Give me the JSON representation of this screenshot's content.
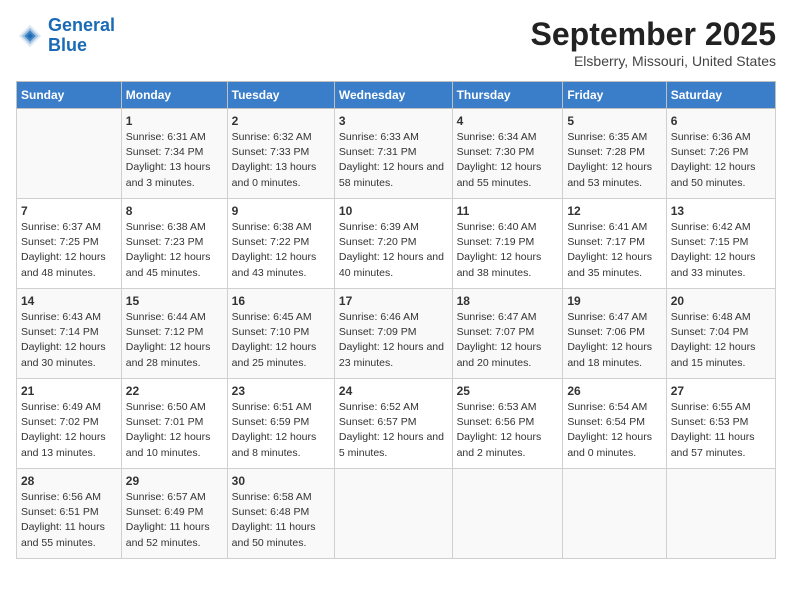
{
  "logo": {
    "line1": "General",
    "line2": "Blue"
  },
  "title": "September 2025",
  "subtitle": "Elsberry, Missouri, United States",
  "days_of_week": [
    "Sunday",
    "Monday",
    "Tuesday",
    "Wednesday",
    "Thursday",
    "Friday",
    "Saturday"
  ],
  "weeks": [
    [
      {
        "day": "",
        "sunrise": "",
        "sunset": "",
        "daylight": ""
      },
      {
        "day": "1",
        "sunrise": "Sunrise: 6:31 AM",
        "sunset": "Sunset: 7:34 PM",
        "daylight": "Daylight: 13 hours and 3 minutes."
      },
      {
        "day": "2",
        "sunrise": "Sunrise: 6:32 AM",
        "sunset": "Sunset: 7:33 PM",
        "daylight": "Daylight: 13 hours and 0 minutes."
      },
      {
        "day": "3",
        "sunrise": "Sunrise: 6:33 AM",
        "sunset": "Sunset: 7:31 PM",
        "daylight": "Daylight: 12 hours and 58 minutes."
      },
      {
        "day": "4",
        "sunrise": "Sunrise: 6:34 AM",
        "sunset": "Sunset: 7:30 PM",
        "daylight": "Daylight: 12 hours and 55 minutes."
      },
      {
        "day": "5",
        "sunrise": "Sunrise: 6:35 AM",
        "sunset": "Sunset: 7:28 PM",
        "daylight": "Daylight: 12 hours and 53 minutes."
      },
      {
        "day": "6",
        "sunrise": "Sunrise: 6:36 AM",
        "sunset": "Sunset: 7:26 PM",
        "daylight": "Daylight: 12 hours and 50 minutes."
      }
    ],
    [
      {
        "day": "7",
        "sunrise": "Sunrise: 6:37 AM",
        "sunset": "Sunset: 7:25 PM",
        "daylight": "Daylight: 12 hours and 48 minutes."
      },
      {
        "day": "8",
        "sunrise": "Sunrise: 6:38 AM",
        "sunset": "Sunset: 7:23 PM",
        "daylight": "Daylight: 12 hours and 45 minutes."
      },
      {
        "day": "9",
        "sunrise": "Sunrise: 6:38 AM",
        "sunset": "Sunset: 7:22 PM",
        "daylight": "Daylight: 12 hours and 43 minutes."
      },
      {
        "day": "10",
        "sunrise": "Sunrise: 6:39 AM",
        "sunset": "Sunset: 7:20 PM",
        "daylight": "Daylight: 12 hours and 40 minutes."
      },
      {
        "day": "11",
        "sunrise": "Sunrise: 6:40 AM",
        "sunset": "Sunset: 7:19 PM",
        "daylight": "Daylight: 12 hours and 38 minutes."
      },
      {
        "day": "12",
        "sunrise": "Sunrise: 6:41 AM",
        "sunset": "Sunset: 7:17 PM",
        "daylight": "Daylight: 12 hours and 35 minutes."
      },
      {
        "day": "13",
        "sunrise": "Sunrise: 6:42 AM",
        "sunset": "Sunset: 7:15 PM",
        "daylight": "Daylight: 12 hours and 33 minutes."
      }
    ],
    [
      {
        "day": "14",
        "sunrise": "Sunrise: 6:43 AM",
        "sunset": "Sunset: 7:14 PM",
        "daylight": "Daylight: 12 hours and 30 minutes."
      },
      {
        "day": "15",
        "sunrise": "Sunrise: 6:44 AM",
        "sunset": "Sunset: 7:12 PM",
        "daylight": "Daylight: 12 hours and 28 minutes."
      },
      {
        "day": "16",
        "sunrise": "Sunrise: 6:45 AM",
        "sunset": "Sunset: 7:10 PM",
        "daylight": "Daylight: 12 hours and 25 minutes."
      },
      {
        "day": "17",
        "sunrise": "Sunrise: 6:46 AM",
        "sunset": "Sunset: 7:09 PM",
        "daylight": "Daylight: 12 hours and 23 minutes."
      },
      {
        "day": "18",
        "sunrise": "Sunrise: 6:47 AM",
        "sunset": "Sunset: 7:07 PM",
        "daylight": "Daylight: 12 hours and 20 minutes."
      },
      {
        "day": "19",
        "sunrise": "Sunrise: 6:47 AM",
        "sunset": "Sunset: 7:06 PM",
        "daylight": "Daylight: 12 hours and 18 minutes."
      },
      {
        "day": "20",
        "sunrise": "Sunrise: 6:48 AM",
        "sunset": "Sunset: 7:04 PM",
        "daylight": "Daylight: 12 hours and 15 minutes."
      }
    ],
    [
      {
        "day": "21",
        "sunrise": "Sunrise: 6:49 AM",
        "sunset": "Sunset: 7:02 PM",
        "daylight": "Daylight: 12 hours and 13 minutes."
      },
      {
        "day": "22",
        "sunrise": "Sunrise: 6:50 AM",
        "sunset": "Sunset: 7:01 PM",
        "daylight": "Daylight: 12 hours and 10 minutes."
      },
      {
        "day": "23",
        "sunrise": "Sunrise: 6:51 AM",
        "sunset": "Sunset: 6:59 PM",
        "daylight": "Daylight: 12 hours and 8 minutes."
      },
      {
        "day": "24",
        "sunrise": "Sunrise: 6:52 AM",
        "sunset": "Sunset: 6:57 PM",
        "daylight": "Daylight: 12 hours and 5 minutes."
      },
      {
        "day": "25",
        "sunrise": "Sunrise: 6:53 AM",
        "sunset": "Sunset: 6:56 PM",
        "daylight": "Daylight: 12 hours and 2 minutes."
      },
      {
        "day": "26",
        "sunrise": "Sunrise: 6:54 AM",
        "sunset": "Sunset: 6:54 PM",
        "daylight": "Daylight: 12 hours and 0 minutes."
      },
      {
        "day": "27",
        "sunrise": "Sunrise: 6:55 AM",
        "sunset": "Sunset: 6:53 PM",
        "daylight": "Daylight: 11 hours and 57 minutes."
      }
    ],
    [
      {
        "day": "28",
        "sunrise": "Sunrise: 6:56 AM",
        "sunset": "Sunset: 6:51 PM",
        "daylight": "Daylight: 11 hours and 55 minutes."
      },
      {
        "day": "29",
        "sunrise": "Sunrise: 6:57 AM",
        "sunset": "Sunset: 6:49 PM",
        "daylight": "Daylight: 11 hours and 52 minutes."
      },
      {
        "day": "30",
        "sunrise": "Sunrise: 6:58 AM",
        "sunset": "Sunset: 6:48 PM",
        "daylight": "Daylight: 11 hours and 50 minutes."
      },
      {
        "day": "",
        "sunrise": "",
        "sunset": "",
        "daylight": ""
      },
      {
        "day": "",
        "sunrise": "",
        "sunset": "",
        "daylight": ""
      },
      {
        "day": "",
        "sunrise": "",
        "sunset": "",
        "daylight": ""
      },
      {
        "day": "",
        "sunrise": "",
        "sunset": "",
        "daylight": ""
      }
    ]
  ]
}
